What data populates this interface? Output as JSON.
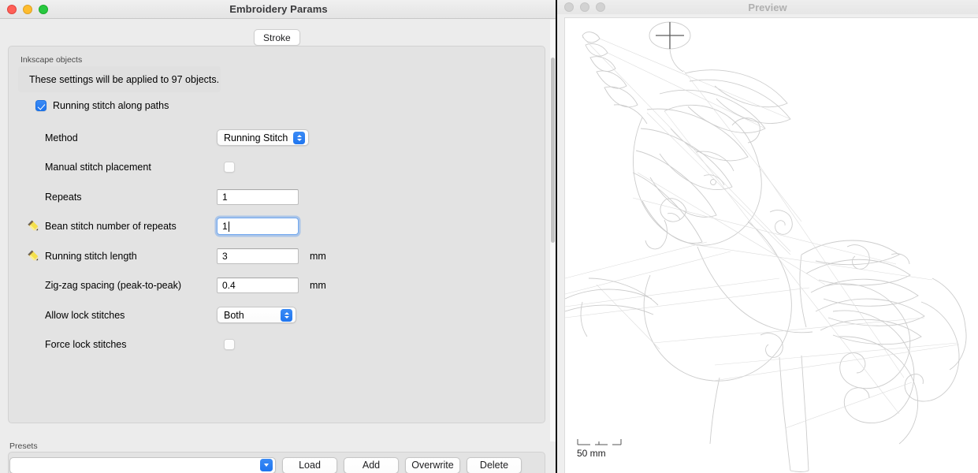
{
  "params_window": {
    "title": "Embroidery Params",
    "traffic_lights": [
      "close-button",
      "minimize-button",
      "maximize-button"
    ],
    "tab": {
      "label": "Stroke"
    },
    "section": {
      "group_label": "Inkscape objects",
      "objects_message": "These settings will be applied to 97 objects."
    },
    "main_checkbox": {
      "label": "Running stitch along paths",
      "checked": true
    },
    "rows": [
      {
        "label": "Method",
        "control": "popup",
        "value": "Running Stitch",
        "unit": "",
        "pencil": false
      },
      {
        "label": "Manual stitch placement",
        "control": "checkbox",
        "value": "",
        "unit": "",
        "checked": false,
        "pencil": false
      },
      {
        "label": "Repeats",
        "control": "textfield",
        "value": "1",
        "unit": "",
        "pencil": false,
        "focused": false
      },
      {
        "label": "Bean stitch number of repeats",
        "control": "textfield",
        "value": "1",
        "unit": "",
        "pencil": true,
        "focused": true
      },
      {
        "label": "Running stitch length",
        "control": "textfield",
        "value": "3",
        "unit": "mm",
        "pencil": true,
        "focused": false
      },
      {
        "label": "Zig-zag spacing (peak-to-peak)",
        "control": "textfield",
        "value": "0.4",
        "unit": "mm",
        "pencil": false,
        "focused": false
      },
      {
        "label": "Allow lock stitches",
        "control": "popup",
        "value": "Both",
        "unit": "",
        "pencil": false
      },
      {
        "label": "Force lock stitches",
        "control": "checkbox",
        "value": "",
        "unit": "",
        "checked": false,
        "pencil": false
      }
    ],
    "presets": {
      "label": "Presets",
      "combo_value": "",
      "buttons": [
        "Load",
        "Add",
        "Overwrite",
        "Delete"
      ]
    }
  },
  "preview_window": {
    "title": "Preview",
    "active": false,
    "scale_bar": {
      "label": "50 mm"
    },
    "artwork": {
      "description": "unicorn-line-drawing",
      "stroke_color": "#c9c9c9",
      "marker": "crosshair-marker"
    }
  },
  "colors": {
    "accent_blue": "#1f75ef",
    "window_bg": "#ececec",
    "card_bg": "#e3e3e3",
    "canvas_bg": "#ffffff"
  }
}
